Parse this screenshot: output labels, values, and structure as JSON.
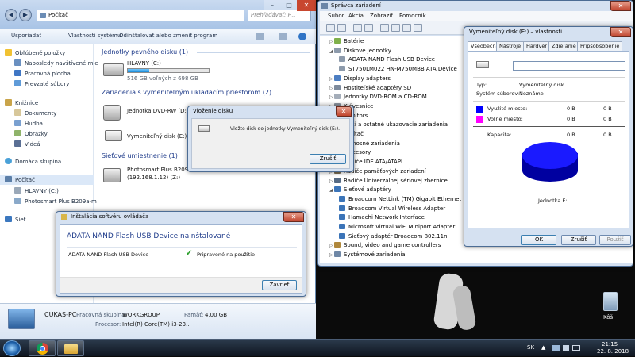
{
  "explorer": {
    "breadcrumb": "Počítač",
    "search_placeholder": "Prehľadávať: P...",
    "toolbar": {
      "organize": "Usporiadať",
      "properties": "Vlastnosti systému",
      "uninstall": "Odinštalovať alebo zmeniť program"
    },
    "nav": {
      "favorites": "Obľúbené položky",
      "recent": "Naposledy navštívené mie",
      "desktop": "Pracovná plocha",
      "downloads": "Prevzaté súbory",
      "libraries": "Knižnice",
      "documents": "Dokumenty",
      "music": "Hudba",
      "pictures": "Obrázky",
      "videos": "Videá",
      "homegroup": "Domáca skupina",
      "computer": "Počítač",
      "drive_c": "HLAVNY (C:)",
      "printer": "Photosmart Plus B209a-m",
      "network": "Sieť"
    },
    "groups": {
      "hdd": "Jednotky pevného disku (1)",
      "removable": "Zariadenia s vymeniteľným ukladacím priestorom (2)",
      "netloc": "Sieťové umiestnenie (1)"
    },
    "drive_c": {
      "name": "HLAVNY (C:)",
      "free": "516 GB voľných z 698 GB",
      "used_fraction": 0.26
    },
    "dvd": "Jednotka DVD-RW (D:)",
    "removable": "Vymeniteľný disk (E:)",
    "printer_name": "Photosmart Plus B209a-z",
    "printer_addr": "(192.168.1.12) (Z:)",
    "details": {
      "pc_name": "CUKAS-PC",
      "workgroup_label": "Pracovná skupina:",
      "workgroup": "WORKGROUP",
      "memory_label": "Pamäť:",
      "memory": "4,00 GB",
      "cpu_label": "Procesor:",
      "cpu": "Intel(R) Core(TM) i3-23..."
    }
  },
  "device_manager": {
    "title": "Správca zariadení",
    "menu": [
      "Súbor",
      "Akcia",
      "Zobraziť",
      "Pomocník"
    ],
    "tree": [
      {
        "label": "Batérie",
        "level": 1,
        "icon": "battery-icon"
      },
      {
        "label": "Diskové jednotky",
        "level": 1,
        "icon": "disk-icon",
        "expanded": true
      },
      {
        "label": "ADATA NAND Flash USB Device",
        "level": 2,
        "icon": "disk-icon"
      },
      {
        "label": "ST750LM022 HN-M750MBB ATA Device",
        "level": 2,
        "icon": "disk-icon"
      },
      {
        "label": "Display adapters",
        "level": 1,
        "icon": "display-icon"
      },
      {
        "label": "Hostiteľské adaptéry SD",
        "level": 1,
        "icon": "sd-icon"
      },
      {
        "label": "Jednotky DVD-ROM a CD-ROM",
        "level": 1,
        "icon": "dvd-icon"
      },
      {
        "label": "Klávesnice",
        "level": 1,
        "icon": "keyboard-icon"
      },
      {
        "label": "Monitors",
        "level": 1,
        "icon": "monitor-icon"
      },
      {
        "label": "Myši a ostatné ukazovacie zariadenia",
        "level": 1,
        "icon": "mouse-icon"
      },
      {
        "label": "Počítač",
        "level": 1,
        "icon": "computer-icon"
      },
      {
        "label": "Prenosné zariadenia",
        "level": 1,
        "icon": "portable-icon"
      },
      {
        "label": "Procesory",
        "level": 1,
        "icon": "cpu-icon"
      },
      {
        "label": "Radiče IDE ATA/ATAPI",
        "level": 1,
        "icon": "ide-icon"
      },
      {
        "label": "Radiče pamäťových zariadení",
        "level": 1,
        "icon": "storage-icon"
      },
      {
        "label": "Radiče Univerzálnej sériovej zbernice",
        "level": 1,
        "icon": "usb-icon"
      },
      {
        "label": "Sieťové adaptéry",
        "level": 1,
        "icon": "network-icon",
        "expanded": true
      },
      {
        "label": "Broadcom NetLink (TM) Gigabit Ethernet",
        "level": 2,
        "icon": "network-icon"
      },
      {
        "label": "Broadcom Virtual Wireless Adapter",
        "level": 2,
        "icon": "network-icon"
      },
      {
        "label": "Hamachi Network Interface",
        "level": 2,
        "icon": "network-icon"
      },
      {
        "label": "Microsoft Virtual WiFi Miniport Adapter",
        "level": 2,
        "icon": "network-icon"
      },
      {
        "label": "Sieťový adaptér Broadcom 802.11n",
        "level": 2,
        "icon": "network-icon"
      },
      {
        "label": "Sound, video and game controllers",
        "level": 1,
        "icon": "sound-icon"
      },
      {
        "label": "Systémové zariadenia",
        "level": 1,
        "icon": "system-icon"
      }
    ]
  },
  "properties": {
    "title": "Vymeniteľný disk (E:) – vlastnosti",
    "tabs": [
      "Všeobecné",
      "Nástroje",
      "Hardvér",
      "Zdieľanie",
      "Pripsobsobenie"
    ],
    "type_label": "Typ:",
    "type_value": "Vymeniteľný disk",
    "fs_label": "Systém súborov:",
    "fs_value": "Neznáme",
    "used_label": "Využité miesto:",
    "used_value1": "0 B",
    "used_value2": "0 B",
    "free_label": "Voľné miesto:",
    "free_value1": "0 B",
    "free_value2": "0 B",
    "cap_label": "Kapacita:",
    "cap_value1": "0 B",
    "cap_value2": "0 B",
    "drive_label": "Jednotka E:",
    "ok": "OK",
    "cancel": "Zrušiť",
    "apply": "Použiť",
    "colors": {
      "used": "#0000ff",
      "free": "#ff00ff"
    }
  },
  "insert_dialog": {
    "title": "Vloženie disku",
    "message": "Vložte disk do jednotky Vymeniteľný disk (E:).",
    "cancel": "Zrušiť"
  },
  "install_dialog": {
    "title": "Inštalácia softvéru ovládača",
    "heading": "ADATA NAND Flash USB Device nainštalované",
    "device": "ADATA NAND Flash USB Device",
    "status": "Pripravené na použitie",
    "close": "Zavrieť"
  },
  "desktop": {
    "recycle_bin": "Kôš"
  },
  "taskbar": {
    "lang": "SK",
    "time": "21:15",
    "date": "22. 8. 2018"
  }
}
